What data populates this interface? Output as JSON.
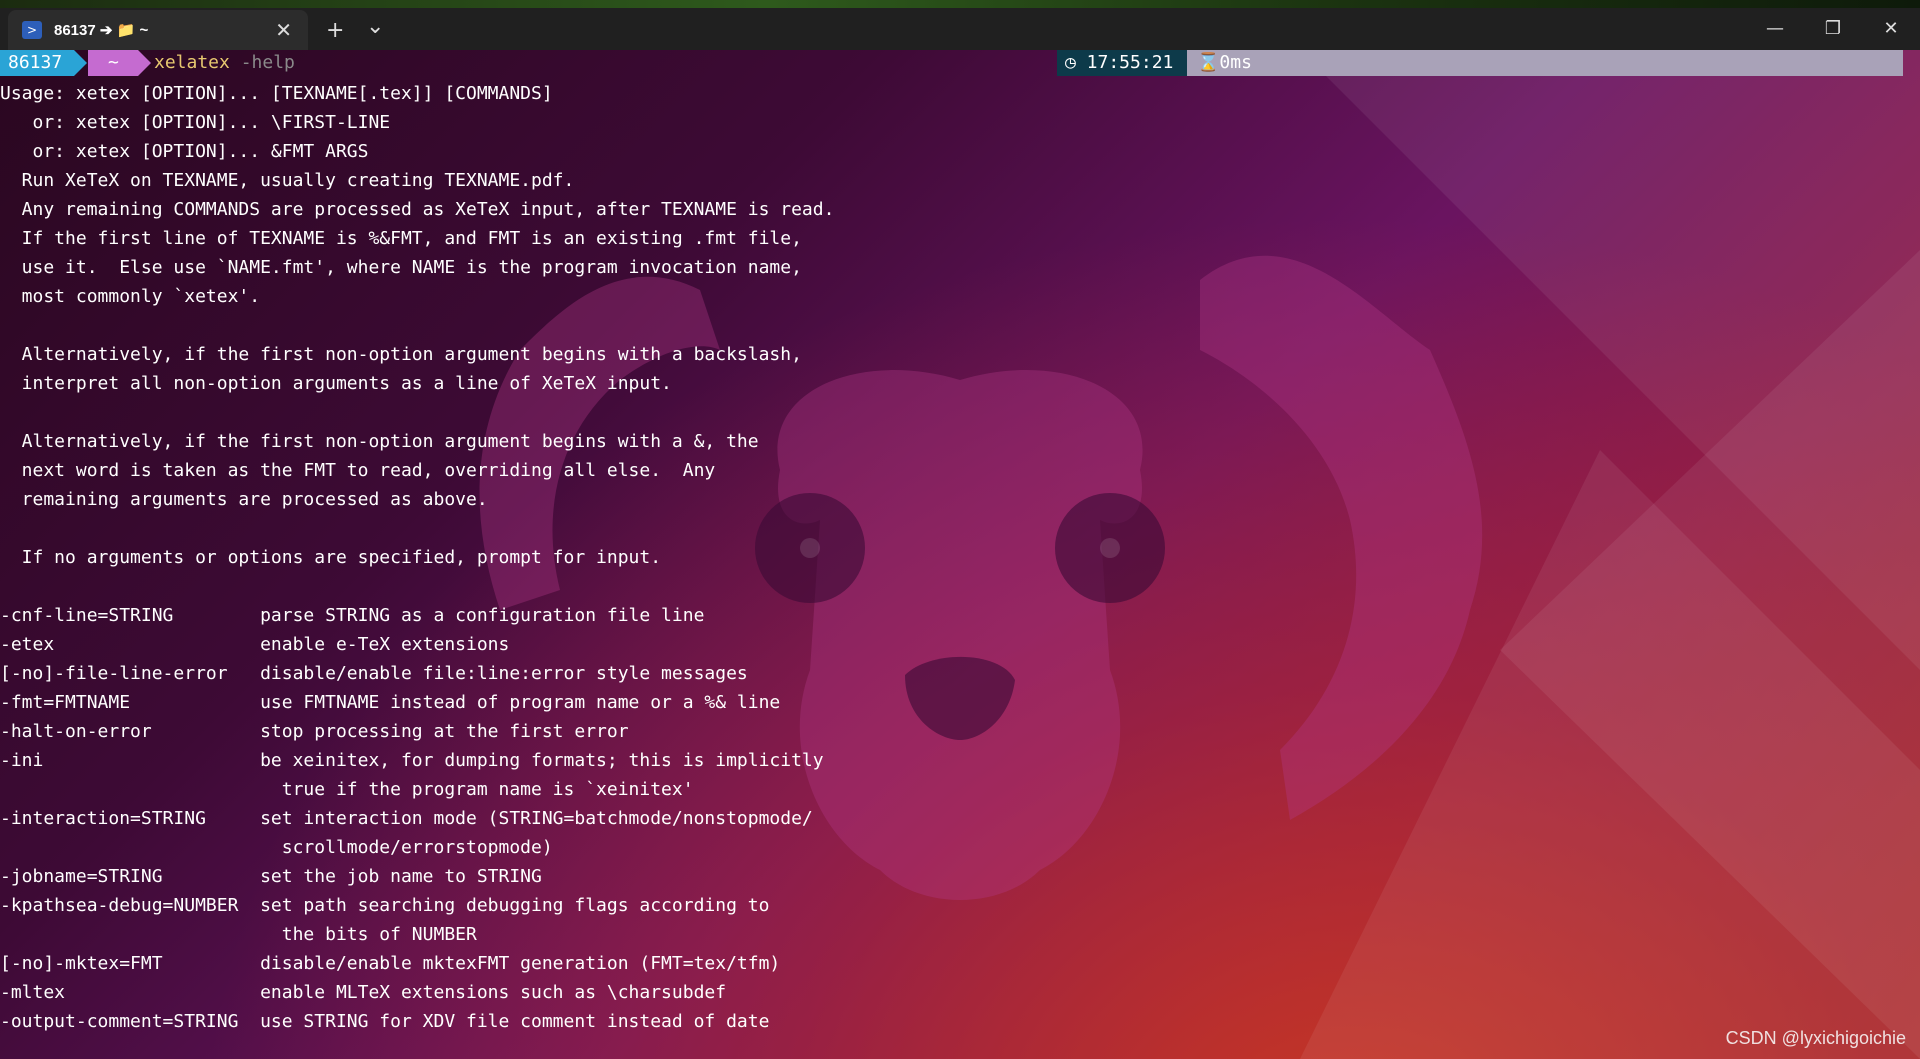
{
  "tabbar": {
    "tab_title": "86137 ➔ 📁 ~",
    "tab_icon": "terminal-icon",
    "close_glyph": "✕",
    "new_tab_glyph": "+",
    "dropdown_glyph": "⌄"
  },
  "window": {
    "minimize": "—",
    "restore": "❐",
    "close": "✕"
  },
  "prompt": {
    "user": "86137",
    "dir": "~",
    "command": "xelatex",
    "arg": "-help",
    "time": "◷ 17:55:21",
    "duration": "⌛0ms"
  },
  "colors": {
    "user_segment": "#2aa4d6",
    "dir_segment": "#c56bd0",
    "time_segment": "#0d3a4a",
    "duration_segment": "#a9a2b8",
    "command": "#e7c870"
  },
  "output": {
    "lines": [
      "Usage: xetex [OPTION]... [TEXNAME[.tex]] [COMMANDS]",
      "   or: xetex [OPTION]... \\FIRST-LINE",
      "   or: xetex [OPTION]... &FMT ARGS",
      "  Run XeTeX on TEXNAME, usually creating TEXNAME.pdf.",
      "  Any remaining COMMANDS are processed as XeTeX input, after TEXNAME is read.",
      "  If the first line of TEXNAME is %&FMT, and FMT is an existing .fmt file,",
      "  use it.  Else use `NAME.fmt', where NAME is the program invocation name,",
      "  most commonly `xetex'.",
      "",
      "  Alternatively, if the first non-option argument begins with a backslash,",
      "  interpret all non-option arguments as a line of XeTeX input.",
      "",
      "  Alternatively, if the first non-option argument begins with a &, the",
      "  next word is taken as the FMT to read, overriding all else.  Any",
      "  remaining arguments are processed as above.",
      "",
      "  If no arguments or options are specified, prompt for input.",
      "",
      "-cnf-line=STRING        parse STRING as a configuration file line",
      "-etex                   enable e-TeX extensions",
      "[-no]-file-line-error   disable/enable file:line:error style messages",
      "-fmt=FMTNAME            use FMTNAME instead of program name or a %& line",
      "-halt-on-error          stop processing at the first error",
      "-ini                    be xeinitex, for dumping formats; this is implicitly",
      "                          true if the program name is `xeinitex'",
      "-interaction=STRING     set interaction mode (STRING=batchmode/nonstopmode/",
      "                          scrollmode/errorstopmode)",
      "-jobname=STRING         set the job name to STRING",
      "-kpathsea-debug=NUMBER  set path searching debugging flags according to",
      "                          the bits of NUMBER",
      "[-no]-mktex=FMT         disable/enable mktexFMT generation (FMT=tex/tfm)",
      "-mltex                  enable MLTeX extensions such as \\charsubdef",
      "-output-comment=STRING  use STRING for XDV file comment instead of date"
    ]
  },
  "watermark": "CSDN @lyxichigoichie"
}
